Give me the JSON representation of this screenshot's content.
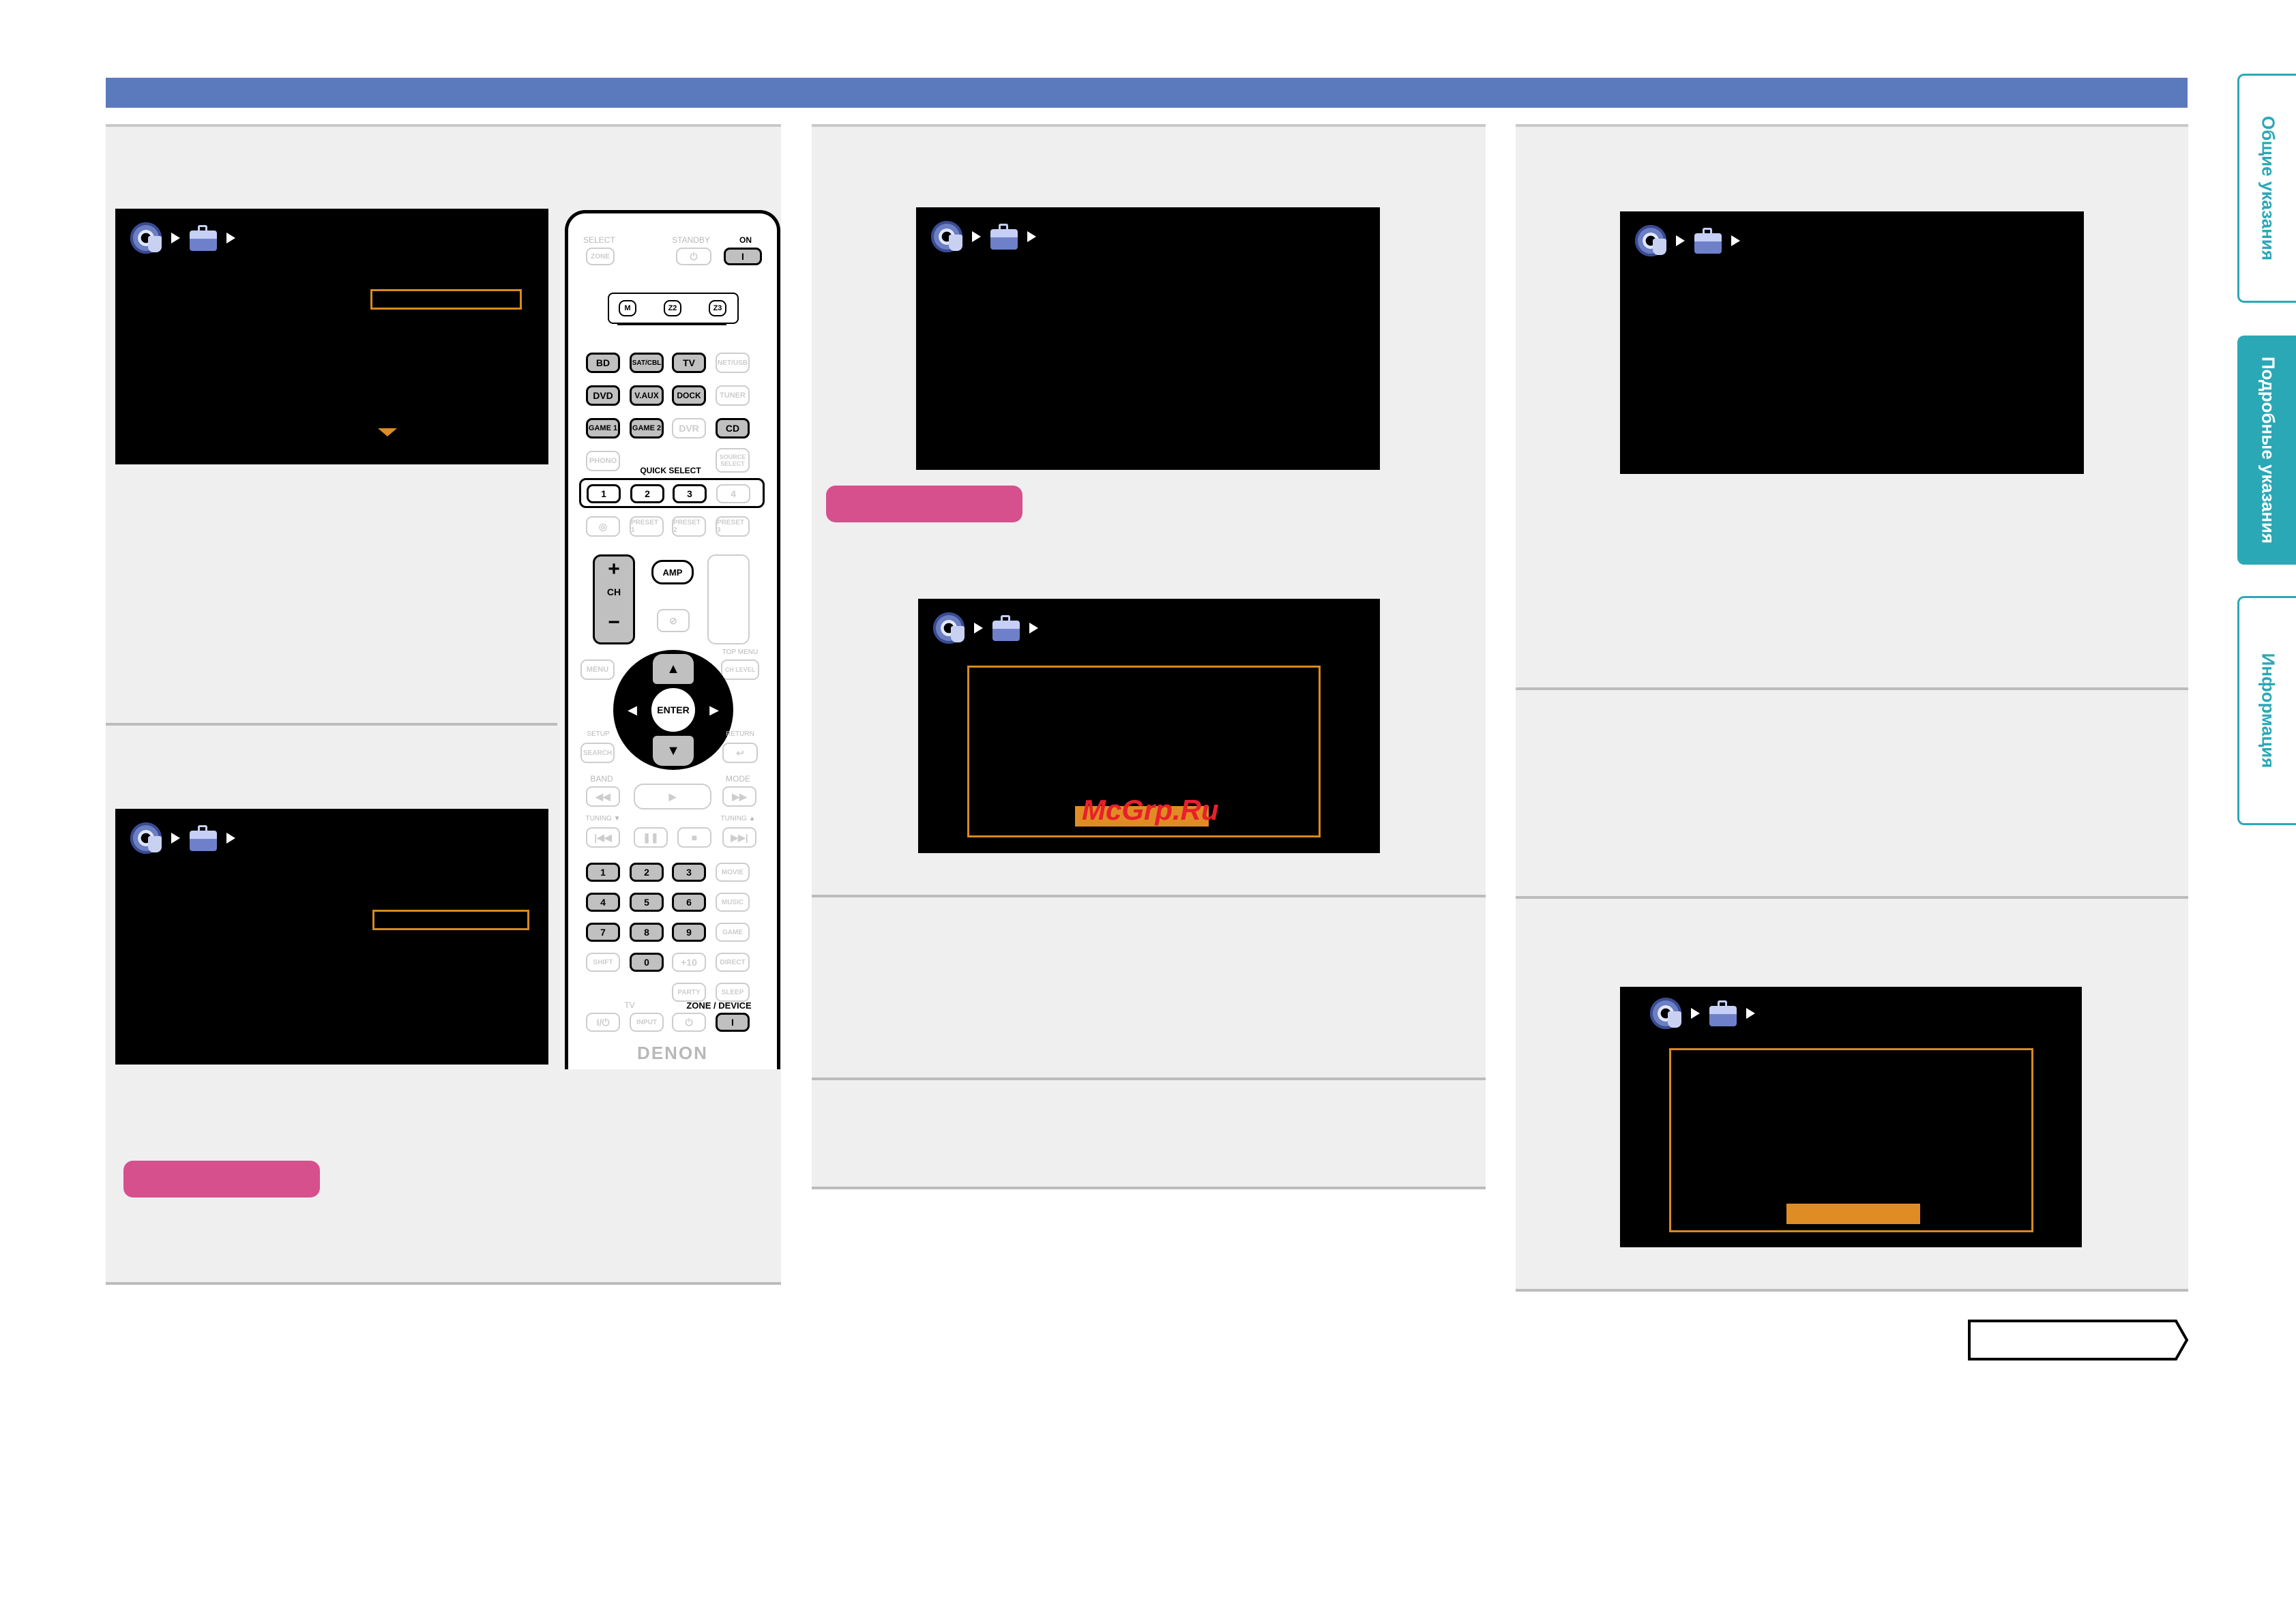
{
  "header": {
    "bar_color": "#5b79bd"
  },
  "colors": {
    "accent_orange": "#e08c25",
    "note_pink": "#d6508d",
    "tab_teal": "#2aa8b6"
  },
  "remote": {
    "top_labels": {
      "select": "SELECT",
      "zone": "ZONE",
      "standby": "STANDBY",
      "on": "ON"
    },
    "zone_buttons": [
      "M",
      "Z2",
      "Z3"
    ],
    "source_rows": [
      [
        "BD",
        "SAT/CBL",
        "TV",
        "NET/USB"
      ],
      [
        "DVD",
        "V.AUX",
        "DOCK",
        "TUNER"
      ],
      [
        "GAME 1",
        "GAME 2",
        "DVR",
        "CD"
      ],
      [
        "PHONO",
        "",
        "",
        "SOURCE SELECT"
      ]
    ],
    "quick_select_label": "QUICK SELECT",
    "quick_buttons": [
      "1",
      "2",
      "3",
      "4"
    ],
    "preset_row": [
      "",
      "PRESET 1",
      "PRESET 2",
      "PRESET 3"
    ],
    "ch_label": "CH",
    "amp_label": "AMP",
    "menu_label": "MENU",
    "ch_level_label": "CH LEVEL",
    "top_menu_label": "TOP MENU",
    "enter_label": "ENTER",
    "setup_label": "SETUP",
    "search_label": "SEARCH",
    "return_label": "RETURN",
    "band_label": "BAND",
    "mode_label": "MODE",
    "tuning_down_label": "TUNING ▼",
    "tuning_up_label": "TUNING ▲",
    "numbers": [
      "1",
      "2",
      "3",
      "4",
      "5",
      "6",
      "7",
      "8",
      "9",
      "0",
      "+10"
    ],
    "right_col": [
      "MOVIE",
      "MUSIC",
      "GAME",
      "DIRECT"
    ],
    "shift_label": "SHIFT",
    "party_label": "PARTY",
    "sleep_label": "SLEEP",
    "tv_label": "TV",
    "input_label": "INPUT",
    "zone_device_label": "ZONE / DEVICE",
    "brand": "DENON"
  },
  "watermark": "McGrp.Ru",
  "side_tabs": [
    {
      "label": "Общие указания",
      "active": false
    },
    {
      "label": "Подробные указания",
      "active": true
    },
    {
      "label": "Информация",
      "active": false
    }
  ]
}
